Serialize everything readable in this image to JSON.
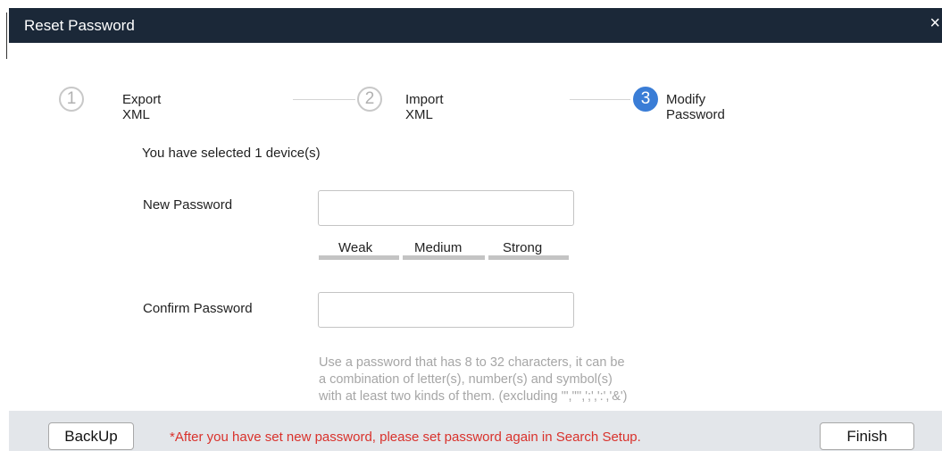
{
  "dialog": {
    "title": "Reset Password",
    "close_glyph": "×"
  },
  "stepper": {
    "steps": [
      {
        "number": "1",
        "label": "Export XML",
        "state": "inactive"
      },
      {
        "number": "2",
        "label": "Import XML",
        "state": "inactive"
      },
      {
        "number": "3",
        "label": "Modify Password",
        "state": "active"
      }
    ]
  },
  "form": {
    "selected_info": "You have selected 1 device(s)",
    "new_password_label": "New Password",
    "new_password_value": "",
    "confirm_password_label": "Confirm Password",
    "confirm_password_value": "",
    "strength_levels": [
      "Weak",
      "Medium",
      "Strong"
    ],
    "hint_lines": [
      "Use a password that has 8 to 32 characters, it can be",
      "a combination of letter(s), number(s) and symbol(s)",
      "with at least two kinds of them. (excluding '\",'\"',';',':','&')"
    ]
  },
  "footer": {
    "backup_label": "BackUp",
    "warning_text": "*After you have set new password, please set password again in Search Setup.",
    "finish_label": "Finish"
  },
  "colors": {
    "titlebar_bg": "#1b2838",
    "active_step": "#3a7dd6",
    "warning_text": "#d9322c",
    "footer_bg": "#e3e6ea",
    "hint_text": "#a6a6a6"
  }
}
